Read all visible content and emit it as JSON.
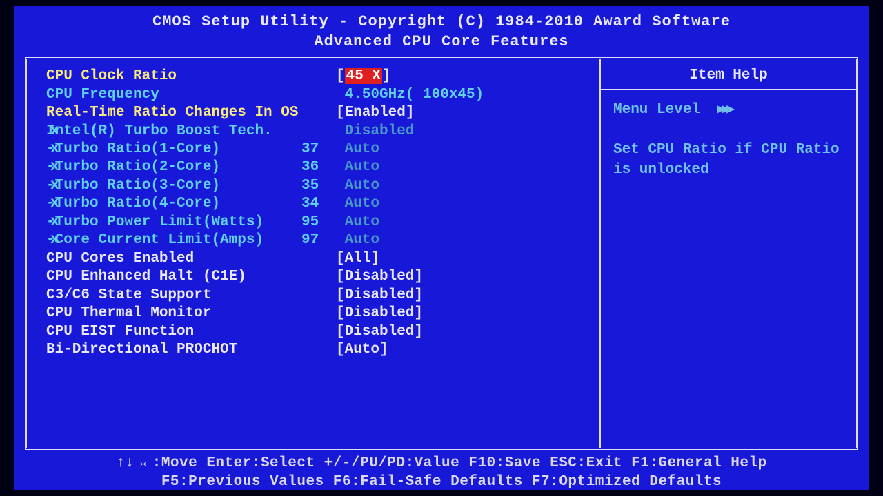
{
  "header": {
    "title": "CMOS Setup Utility - Copyright (C) 1984-2010 Award Software",
    "subtitle": "Advanced CPU Core Features"
  },
  "settings": [
    {
      "label": "CPU Clock Ratio",
      "num": "",
      "value": "45 X",
      "kind": "yellow",
      "brackets": true,
      "highlight": true,
      "marker": ""
    },
    {
      "label": "CPU Frequency",
      "num": "",
      "value": "4.50GHz( 100x45)",
      "kind": "cyan-ro",
      "brackets": false,
      "marker": ""
    },
    {
      "label": "Real-Time Ratio Changes In OS",
      "num": "",
      "value": "Enabled",
      "kind": "yellow",
      "brackets": true,
      "marker": ""
    },
    {
      "label": "Intel(R) Turbo Boost Tech.",
      "num": "",
      "value": "Disabled",
      "kind": "cyan",
      "brackets": false,
      "marker": "x"
    },
    {
      "label": "-Turbo Ratio(1-Core)",
      "num": "37",
      "value": "Auto",
      "kind": "cyan",
      "brackets": false,
      "marker": "x"
    },
    {
      "label": "-Turbo Ratio(2-Core)",
      "num": "36",
      "value": "Auto",
      "kind": "cyan",
      "brackets": false,
      "marker": "x"
    },
    {
      "label": "-Turbo Ratio(3-Core)",
      "num": "35",
      "value": "Auto",
      "kind": "cyan",
      "brackets": false,
      "marker": "x"
    },
    {
      "label": "-Turbo Ratio(4-Core)",
      "num": "34",
      "value": "Auto",
      "kind": "cyan",
      "brackets": false,
      "marker": "x"
    },
    {
      "label": "-Turbo Power Limit(Watts)",
      "num": "95",
      "value": "Auto",
      "kind": "cyan",
      "brackets": false,
      "marker": "x"
    },
    {
      "label": "-Core Current Limit(Amps)",
      "num": "97",
      "value": "Auto",
      "kind": "cyan",
      "brackets": false,
      "marker": "x"
    },
    {
      "label": "CPU Cores Enabled",
      "num": "",
      "value": "All",
      "kind": "white",
      "brackets": true,
      "marker": ""
    },
    {
      "label": "CPU Enhanced Halt (C1E)",
      "num": "",
      "value": "Disabled",
      "kind": "white",
      "brackets": true,
      "marker": ""
    },
    {
      "label": "C3/C6 State Support",
      "num": "",
      "value": "Disabled",
      "kind": "white",
      "brackets": true,
      "marker": ""
    },
    {
      "label": "CPU Thermal Monitor",
      "num": "",
      "value": "Disabled",
      "kind": "white",
      "brackets": true,
      "marker": ""
    },
    {
      "label": "CPU EIST Function",
      "num": "",
      "value": "Disabled",
      "kind": "white",
      "brackets": true,
      "marker": ""
    },
    {
      "label": "Bi-Directional PROCHOT",
      "num": "",
      "value": "Auto",
      "kind": "white",
      "brackets": true,
      "marker": ""
    }
  ],
  "help": {
    "title": "Item Help",
    "menu_level": "Menu Level",
    "arrows": "▶▶▶",
    "text": "Set CPU Ratio if CPU Ratio is unlocked"
  },
  "footer": {
    "line1": "↑↓→←:Move   Enter:Select   +/-/PU/PD:Value   F10:Save   ESC:Exit   F1:General Help",
    "line2": "F5:Previous Values   F6:Fail-Safe Defaults   F7:Optimized Defaults"
  }
}
